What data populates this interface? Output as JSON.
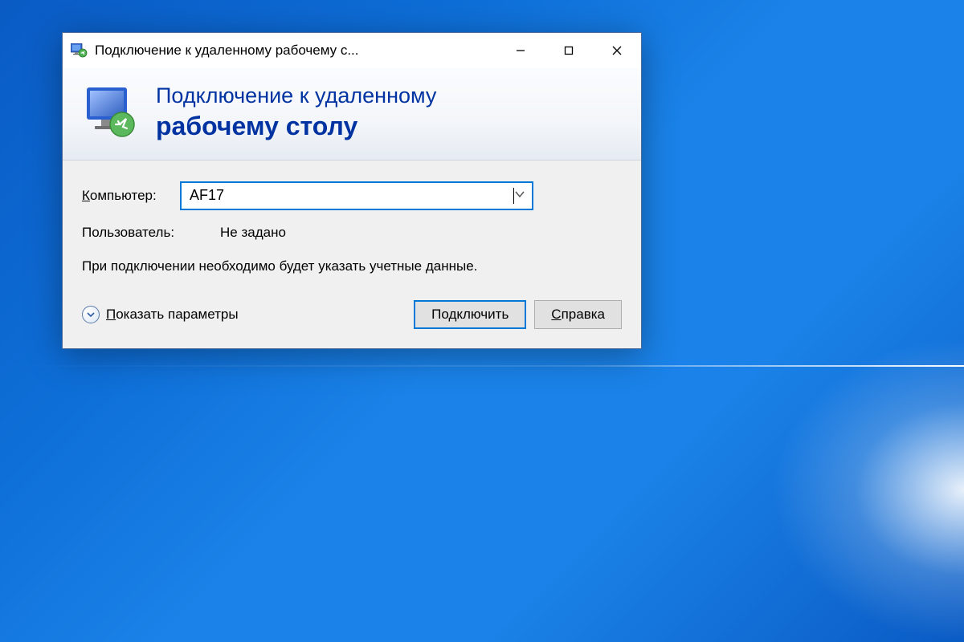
{
  "window": {
    "title": "Подключение к удаленному рабочему с..."
  },
  "banner": {
    "line1": "Подключение к удаленному",
    "line2": "рабочему столу"
  },
  "form": {
    "computer_label": "Компьютер:",
    "computer_value": "AF17",
    "user_label": "Пользователь:",
    "user_value": "Не задано",
    "note": "При подключении необходимо будет указать учетные данные."
  },
  "footer": {
    "show_options": "Показать параметры",
    "connect": "Подключить",
    "help": "Справка"
  }
}
